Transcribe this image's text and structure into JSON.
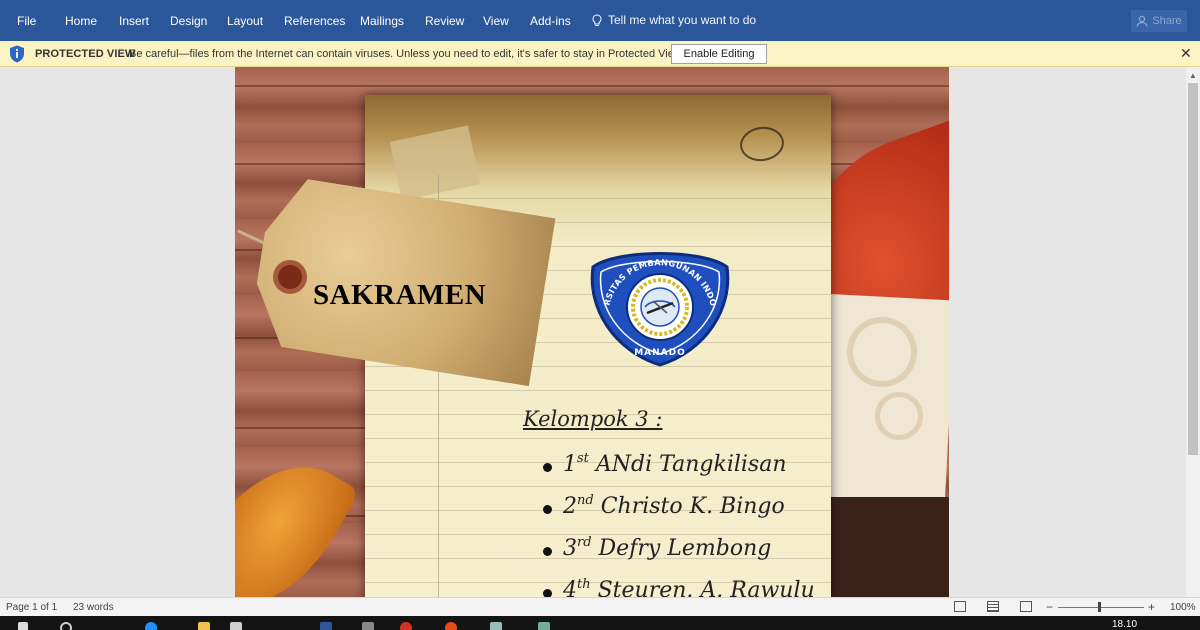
{
  "ribbon": {
    "tabs": [
      "File",
      "Home",
      "Insert",
      "Design",
      "Layout",
      "References",
      "Mailings",
      "Review",
      "View",
      "Add-ins"
    ],
    "tell_me": "Tell me what you want to do",
    "share": "Share"
  },
  "protected_view": {
    "title": "PROTECTED VIEW",
    "message": "Be careful—files from the Internet can contain viruses. Unless you need to edit, it's safer to stay in Protected View.",
    "button": "Enable Editing"
  },
  "document": {
    "tag_title": "SAKRAMEN",
    "logo_text_top": "UNIVERSITAS PEMBANGUNAN INDONESIA",
    "logo_text_bottom": "MANADO",
    "group_label": "Kelompok 3 :",
    "members": [
      {
        "ordinal": "1",
        "suffix": "st",
        "name": "ANdi Tangkilisan"
      },
      {
        "ordinal": "2",
        "suffix": "nd",
        "name": "Christo K. Bingo"
      },
      {
        "ordinal": "3",
        "suffix": "rd",
        "name": "Defry Lembong"
      },
      {
        "ordinal": "4",
        "suffix": "th",
        "name": "Steuren. A. Rawulu"
      }
    ]
  },
  "status_bar": {
    "page": "Page 1 of 1",
    "words": "23 words",
    "zoom": "100%"
  },
  "taskbar": {
    "clock": "18.10"
  },
  "colors": {
    "ribbon": "#2b579a",
    "protected_bar": "#fbf3c4",
    "logo_blue": "#1f4fbf"
  }
}
